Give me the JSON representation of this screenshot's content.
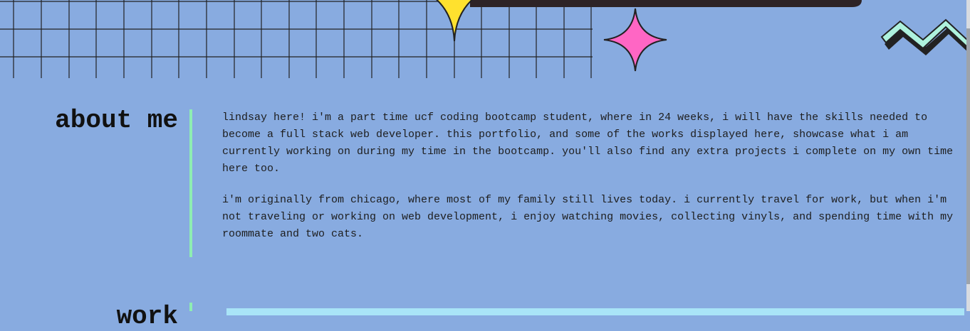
{
  "about": {
    "heading": "about me",
    "paragraphs": [
      "lindsay here! i'm a part time ucf coding bootcamp student, where in 24 weeks, i will have the skills needed to become a full stack web developer. this portfolio, and some of the works displayed here, showcase what i am currently working on during my time in the bootcamp. you'll also find any extra projects i complete on my own time here too.",
      "i'm originally from chicago, where most of my family still lives today. i currently travel for work, but when i'm not traveling or working on web development, i enjoy watching movies, collecting vinyls, and spending time with my roommate and two cats."
    ]
  },
  "next_section": {
    "heading": "work"
  },
  "decorations": {
    "grid": "grid-pattern",
    "yellow_star": "sparkle-star-icon",
    "pink_star": "sparkle-star-icon",
    "zigzag": "zigzag-icon"
  },
  "colors": {
    "background": "#88abe0",
    "accent_green": "#8eeeb2",
    "star_yellow": "#ffe12e",
    "star_pink": "#ff66c4",
    "zigzag_mint": "#aef2dd",
    "panel_cyan": "#a9e4f7"
  }
}
